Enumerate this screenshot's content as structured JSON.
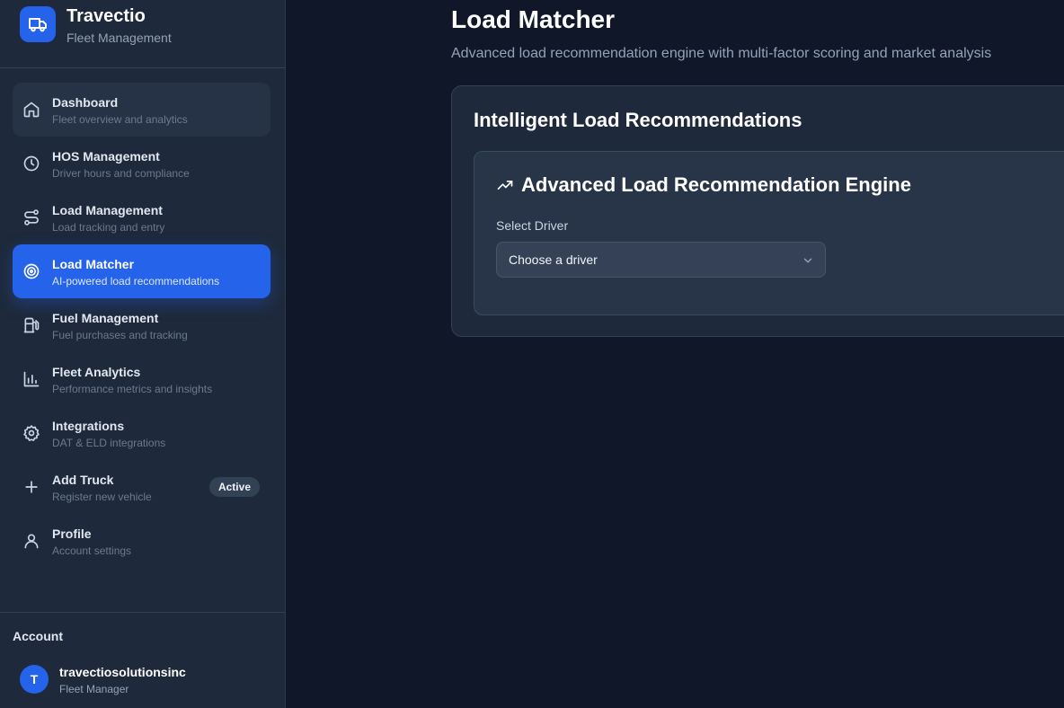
{
  "brand": {
    "title": "Travectio",
    "subtitle": "Fleet Management",
    "logo_icon": "truck-icon",
    "accent": "#2563eb"
  },
  "sidebar": {
    "items": [
      {
        "label": "Dashboard",
        "desc": "Fleet overview and analytics",
        "icon": "home-icon",
        "state": "hover"
      },
      {
        "label": "HOS Management",
        "desc": "Driver hours and compliance",
        "icon": "clock-icon"
      },
      {
        "label": "Load Management",
        "desc": "Load tracking and entry",
        "icon": "route-icon"
      },
      {
        "label": "Load Matcher",
        "desc": "AI-powered load recommendations",
        "icon": "target-icon",
        "state": "active"
      },
      {
        "label": "Fuel Management",
        "desc": "Fuel purchases and tracking",
        "icon": "fuel-icon"
      },
      {
        "label": "Fleet Analytics",
        "desc": "Performance metrics and insights",
        "icon": "bar-chart-icon"
      },
      {
        "label": "Integrations",
        "desc": "DAT & ELD integrations",
        "icon": "gear-icon"
      },
      {
        "label": "Add Truck",
        "desc": "Register new vehicle",
        "icon": "plus-icon",
        "badge": "Active"
      },
      {
        "label": "Profile",
        "desc": "Account settings",
        "icon": "user-icon"
      }
    ]
  },
  "account": {
    "title": "Account",
    "avatar_initial": "T",
    "username": "travectiosolutionsinc",
    "role": "Fleet Manager"
  },
  "main": {
    "title": "Load Matcher",
    "subtitle": "Advanced load recommendation engine with multi-factor scoring and market analysis",
    "card_title": "Intelligent Load Recommendations",
    "engine": {
      "title": "Advanced Load Recommendation Engine",
      "icon": "trending-up-icon",
      "select_label": "Select Driver",
      "select_value": "Choose a driver"
    }
  }
}
